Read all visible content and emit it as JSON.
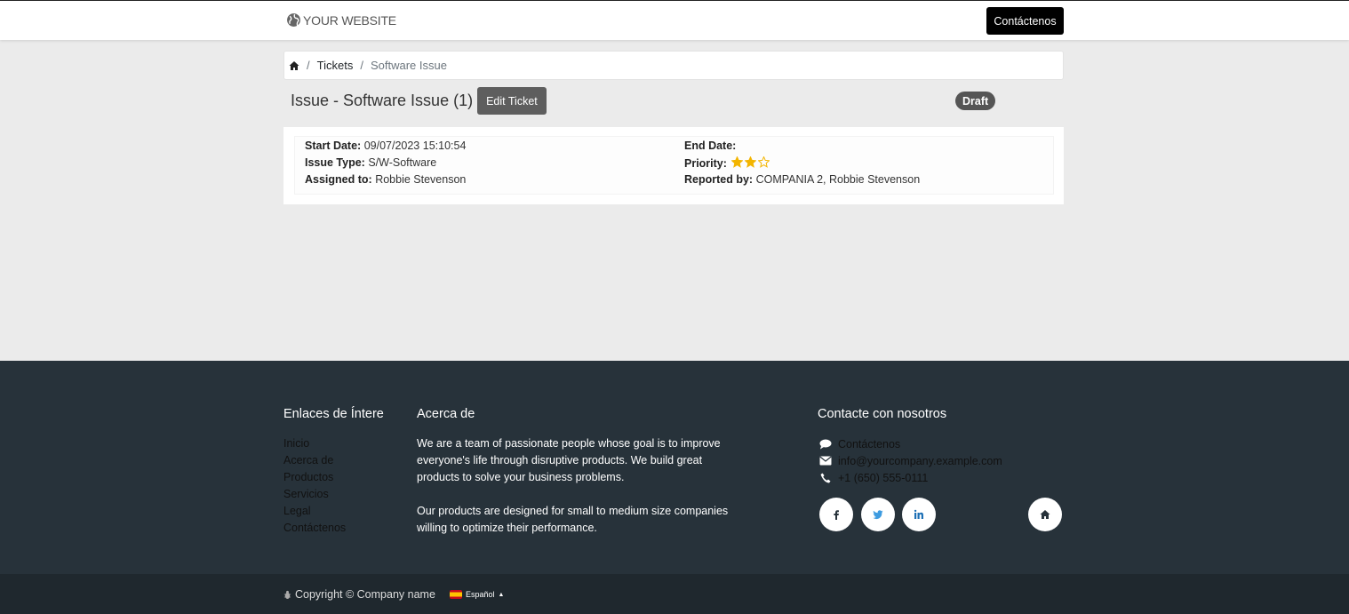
{
  "header": {
    "logo_text": "YOUR WEBSITE",
    "contact_button": "Contáctenos"
  },
  "breadcrumb": {
    "items": [
      "Tickets",
      "Software Issue"
    ]
  },
  "ticket": {
    "title": "Issue - Software Issue",
    "count": "(1)",
    "edit_button": "Edit Ticket",
    "status": "Draft",
    "fields": {
      "start_date_label": "Start Date:",
      "start_date": "09/07/2023 15:10:54",
      "issue_type_label": "Issue Type:",
      "issue_type": "S/W-Software",
      "assigned_to_label": "Assigned to:",
      "assigned_to": "Robbie Stevenson",
      "end_date_label": "End Date:",
      "end_date": "",
      "priority_label": "Priority:",
      "priority_stars_filled": 2,
      "priority_stars_total": 3,
      "reported_by_label": "Reported by:",
      "reported_by": "COMPANIA 2, Robbie Stevenson"
    }
  },
  "footer": {
    "links_title": "Enlaces de Íntere",
    "links": [
      "Inicio",
      "Acerca de",
      "Productos",
      "Servicios",
      "Legal",
      "Contáctenos"
    ],
    "about_title": "Acerca de",
    "about_p1": "We are a team of passionate people whose goal is to improve everyone's life through disruptive products. We build great products to solve your business problems.",
    "about_p2": "Our products are designed for small to medium size companies willing to optimize their performance.",
    "contact_title": "Contacte con nosotros",
    "contact_items": [
      "Contáctenos",
      "info@yourcompany.example.com",
      "+1 (650) 555-0111"
    ],
    "social_icons": [
      "facebook-icon",
      "twitter-icon",
      "linkedin-icon",
      "home-icon"
    ]
  },
  "bottom": {
    "copyright": "Copyright © Company name",
    "language": "Español"
  },
  "colors": {
    "footer_bg": "#27323a",
    "bottom_bg": "#1f282e",
    "star": "#f3b500",
    "badge": "#555555"
  }
}
